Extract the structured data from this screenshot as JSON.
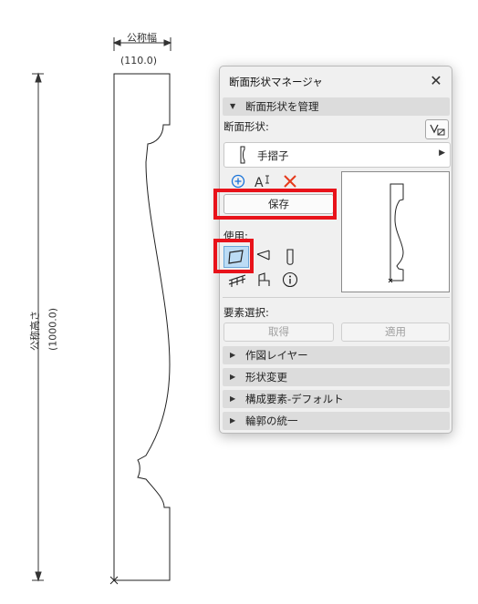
{
  "drawing": {
    "width_label": "公称幅",
    "width_value": "(110.0)",
    "height_label": "公称高さ",
    "height_value": "(1000.0)"
  },
  "dialog": {
    "title": "断面形状マネージャ",
    "close_icon": "close-icon",
    "manage_section": "断面形状を管理",
    "profile_label": "断面形状:",
    "selected_profile": "手摺子",
    "save_button": "保存",
    "use_label": "使用:",
    "element_select_label": "要素選択:",
    "get_button": "取得",
    "apply_button": "適用",
    "collapsed_sections": [
      "作図レイヤー",
      "形状変更",
      "構成要素-デフォルト",
      "輪郭の統一"
    ]
  },
  "colors": {
    "highlight": "#e8121a",
    "selected_tool": "#bcdcf5",
    "add_icon": "#1a73d9",
    "delete_icon": "#e53b1c"
  }
}
